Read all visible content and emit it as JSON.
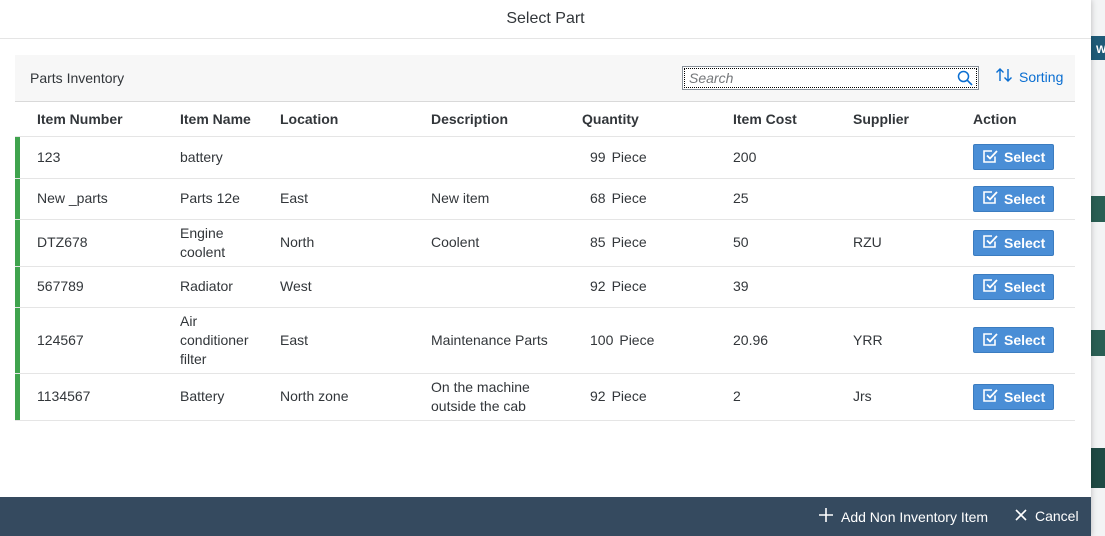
{
  "dialog": {
    "title": "Select Part"
  },
  "toolbar": {
    "title": "Parts Inventory",
    "search_placeholder": "Search",
    "sorting_label": "Sorting"
  },
  "table": {
    "columns": [
      "Item Number",
      "Item Name",
      "Location",
      "Description",
      "Quantity",
      "Item Cost",
      "Supplier",
      "Action"
    ],
    "rows": [
      {
        "item_number": "123",
        "item_name": "battery",
        "location": "",
        "description": "",
        "quantity": "99",
        "unit": "Piece",
        "item_cost": "200",
        "supplier": "",
        "action": "Select"
      },
      {
        "item_number": "New _parts",
        "item_name": "Parts 12e",
        "location": "East",
        "description": "New item",
        "quantity": "68",
        "unit": "Piece",
        "item_cost": "25",
        "supplier": "",
        "action": "Select"
      },
      {
        "item_number": "DTZ678",
        "item_name": "Engine coolent",
        "location": "North",
        "description": "Coolent",
        "quantity": "85",
        "unit": "Piece",
        "item_cost": "50",
        "supplier": "RZU",
        "action": "Select"
      },
      {
        "item_number": "567789",
        "item_name": "Radiator",
        "location": "West",
        "description": "",
        "quantity": "92",
        "unit": "Piece",
        "item_cost": "39",
        "supplier": "",
        "action": "Select"
      },
      {
        "item_number": "124567",
        "item_name": "Air conditioner filter",
        "location": "East",
        "description": "Maintenance Parts",
        "quantity": "100",
        "unit": "Piece",
        "item_cost": "20.96",
        "supplier": "YRR",
        "action": "Select"
      },
      {
        "item_number": "1134567",
        "item_name": "Battery",
        "location": "North zone",
        "description": "On the machine outside the cab",
        "quantity": "92",
        "unit": "Piece",
        "item_cost": "2",
        "supplier": "Jrs",
        "action": "Select"
      }
    ]
  },
  "footer": {
    "add_label": "Add Non Inventory Item",
    "cancel_label": "Cancel"
  },
  "background": {
    "tab_letter": "W"
  },
  "colors": {
    "accent": "#0a6ed1",
    "button": "#4a8ed6",
    "row_marker": "#3fa34d",
    "footer": "#354a5f"
  },
  "icons": {
    "search": "search-icon",
    "sorting": "sort-icon",
    "select": "checkbox-icon",
    "add": "plus-icon",
    "cancel": "close-icon"
  }
}
